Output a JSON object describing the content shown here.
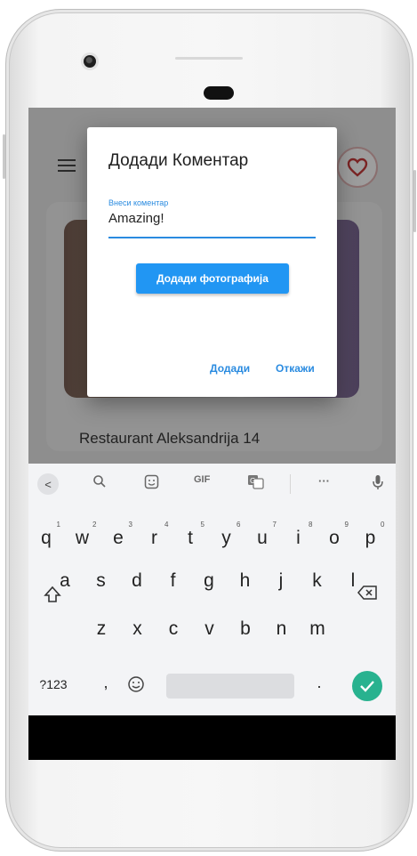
{
  "app": {
    "restaurant_name": "Restaurant Aleksandrija 14",
    "menu_icon": "hamburger-icon",
    "favorite_icon": "heart-icon"
  },
  "dialog": {
    "title": "Додади Коментар",
    "field_label": "Внеси коментар",
    "field_value": "Amazing!",
    "add_photo_button": "Додади фотографија",
    "confirm_button": "Додади",
    "cancel_button": "Откажи"
  },
  "keyboard": {
    "toolbar": {
      "back": "<",
      "gif": "GIF",
      "more": "···"
    },
    "row1": [
      {
        "k": "q",
        "n": "1"
      },
      {
        "k": "w",
        "n": "2"
      },
      {
        "k": "e",
        "n": "3"
      },
      {
        "k": "r",
        "n": "4"
      },
      {
        "k": "t",
        "n": "5"
      },
      {
        "k": "y",
        "n": "6"
      },
      {
        "k": "u",
        "n": "7"
      },
      {
        "k": "i",
        "n": "8"
      },
      {
        "k": "o",
        "n": "9"
      },
      {
        "k": "p",
        "n": "0"
      }
    ],
    "row2": [
      "a",
      "s",
      "d",
      "f",
      "g",
      "h",
      "j",
      "k",
      "l"
    ],
    "row3": [
      "z",
      "x",
      "c",
      "v",
      "b",
      "n",
      "m"
    ],
    "symbols_key": "?123",
    "comma_key": ",",
    "period_key": "."
  },
  "colors": {
    "accent": "#2196f3",
    "enter_key": "#28b28f",
    "scrim": "#8e8e8e"
  }
}
